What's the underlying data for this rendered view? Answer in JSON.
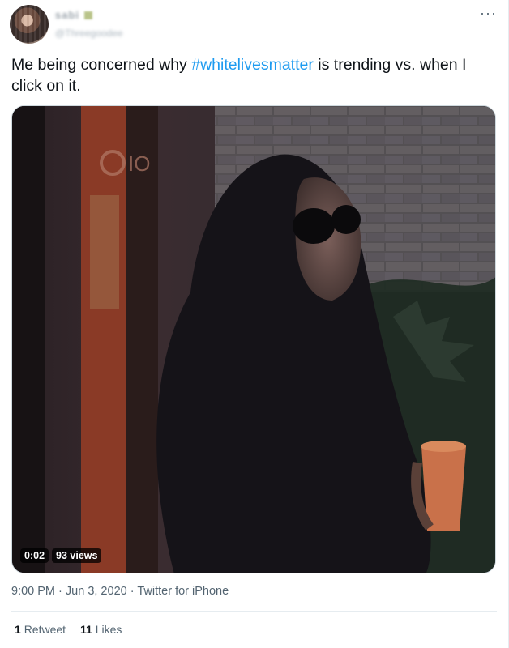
{
  "tweet": {
    "display_name": "sabi",
    "handle": "@Threegoodee",
    "more_icon": "more-horizontal-icon",
    "text_before": "Me being concerned why ",
    "hashtag": "#whitelivesmatter",
    "text_after": " is trending vs. when I click on it.",
    "video": {
      "duration": "0:02",
      "views": "93 views",
      "watermark": "Bio"
    },
    "time": "9:00 PM",
    "date": "Jun 3, 2020",
    "sep": "·",
    "source": "Twitter for iPhone",
    "retweets_count": "1",
    "retweets_label": "Retweet",
    "likes_count": "11",
    "likes_label": "Likes",
    "colors": {
      "link": "#1d9bf0",
      "secondary": "#536471"
    }
  }
}
